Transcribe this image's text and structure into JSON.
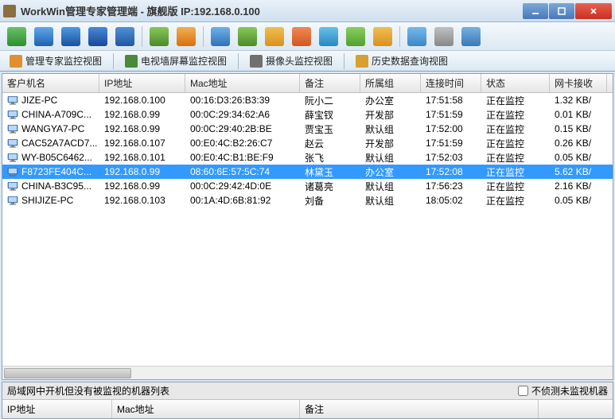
{
  "window": {
    "title": "WorkWin管理专家管理端 - 旗舰版 IP:192.168.0.100"
  },
  "tabs": {
    "t1": "管理专家监控视图",
    "t2": "电视墙屏幕监控视图",
    "t3": "摄像头监控视图",
    "t4": "历史数据查询视图"
  },
  "columns": {
    "c0": "客户机名",
    "c1": "IP地址",
    "c2": "Mac地址",
    "c3": "备注",
    "c4": "所属组",
    "c5": "连接时间",
    "c6": "状态",
    "c7": "网卡接收"
  },
  "rows": [
    {
      "name": "JIZE-PC",
      "ip": "192.168.0.100",
      "mac": "00:16:D3:26:B3:39",
      "remark": "阮小二",
      "group": "办公室",
      "time": "17:51:58",
      "status": "正在监控",
      "recv": "1.32 KB/"
    },
    {
      "name": "CHINA-A709C...",
      "ip": "192.168.0.99",
      "mac": "00:0C:29:34:62:A6",
      "remark": "薛宝钗",
      "group": "开发部",
      "time": "17:51:59",
      "status": "正在监控",
      "recv": "0.01 KB/"
    },
    {
      "name": "WANGYA7-PC",
      "ip": "192.168.0.99",
      "mac": "00:0C:29:40:2B:BE",
      "remark": "贾宝玉",
      "group": "默认组",
      "time": "17:52:00",
      "status": "正在监控",
      "recv": "0.15 KB/"
    },
    {
      "name": "CAC52A7ACD7...",
      "ip": "192.168.0.107",
      "mac": "00:E0:4C:B2:26:C7",
      "remark": "赵云",
      "group": "开发部",
      "time": "17:51:59",
      "status": "正在监控",
      "recv": "0.26 KB/"
    },
    {
      "name": "WY-B05C6462...",
      "ip": "192.168.0.101",
      "mac": "00:E0:4C:B1:BE:F9",
      "remark": "张飞",
      "group": "默认组",
      "time": "17:52:03",
      "status": "正在监控",
      "recv": "0.05 KB/"
    },
    {
      "name": "F8723FE404C...",
      "ip": "192.168.0.99",
      "mac": "08:60:6E:57:5C:74",
      "remark": "林黛玉",
      "group": "办公室",
      "time": "17:52:08",
      "status": "正在监控",
      "recv": "5.62 KB/",
      "selected": true
    },
    {
      "name": "CHINA-B3C95...",
      "ip": "192.168.0.99",
      "mac": "00:0C:29:42:4D:0E",
      "remark": "诸葛亮",
      "group": "默认组",
      "time": "17:56:23",
      "status": "正在监控",
      "recv": "2.16 KB/"
    },
    {
      "name": "SHIJIZE-PC",
      "ip": "192.168.0.103",
      "mac": "00:1A:4D:6B:81:92",
      "remark": "刘备",
      "group": "默认组",
      "time": "18:05:02",
      "status": "正在监控",
      "recv": "0.05 KB/"
    }
  ],
  "bottom": {
    "title": "局域网中开机但没有被监视的机器列表",
    "checkbox": "不侦测未监视机器",
    "cols": {
      "c0": "IP地址",
      "c1": "Mac地址",
      "c2": "备注"
    }
  },
  "icons": {
    "toolbar_colors": [
      "#3aa03a",
      "#2a80c8",
      "#2a60b8",
      "#2850a8",
      "#3060b8",
      "#5a9a3a",
      "#e89020",
      "#4888c8",
      "#5a9a3a",
      "#d8a030",
      "#e07030",
      "#40a0d8",
      "#60b040",
      "#d8a030",
      "#50a0d0",
      "#a0a0a0",
      "#5090d0"
    ]
  }
}
